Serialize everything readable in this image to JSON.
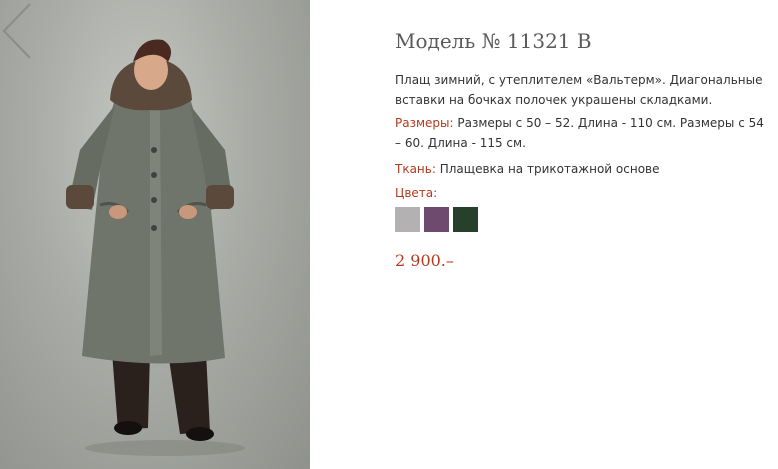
{
  "product": {
    "title": "Модель № 11321 В",
    "description": "Плащ зимний, с утеплителем «Вальтерм». Диагональные вставки на бочках полочек украшены складками.",
    "sizes_label": "Размеры:",
    "sizes_text": " Размеры с 50 – 52. Длина - 110 см. Размеры с 54 – 60. Длина - 115 см.",
    "fabric_label": "Ткань:",
    "fabric_text": " Плащевка на трикотажной основе",
    "colors_label": "Цвета:",
    "swatches": [
      {
        "name": "light-gray",
        "color": "#b3b1b2"
      },
      {
        "name": "purple",
        "color": "#6e4a6e"
      },
      {
        "name": "dark-green",
        "color": "#26402b"
      }
    ],
    "price": "2 900.–"
  },
  "colors": {
    "accent": "#b33a1e",
    "coat": "#6f756b"
  },
  "icons": {
    "prev": "chevron-left-icon"
  }
}
